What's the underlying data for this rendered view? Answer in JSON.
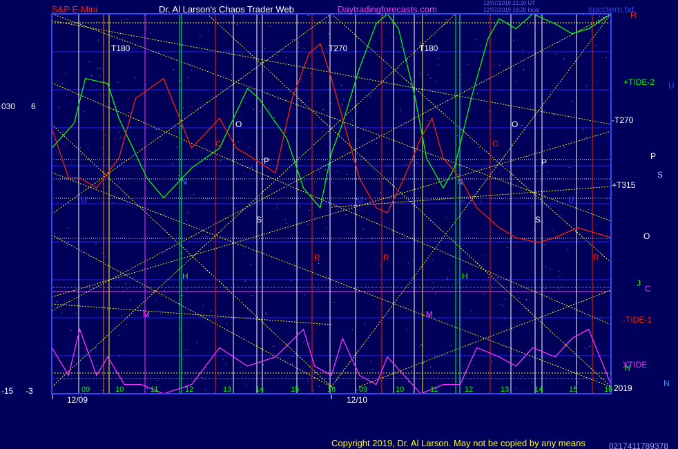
{
  "header": {
    "symbol": "S&P E-Mini",
    "title": "Dr. Al Larson's Chaos Trader Web",
    "site": "Daytradingforecasts.com",
    "stamp1": "12/07/2019 21:20 UT",
    "stamp2": "12/07/2019 16:20 local",
    "file": "spcctern.txt",
    "right_letter": "R"
  },
  "footer": {
    "copyright": "Copyright 2019, Dr. Al Larson. May not be copied by any means",
    "overlay_digits": "0217411789378"
  },
  "colors": {
    "background": "#00005a",
    "grid": "#2222ff",
    "yellow": "#ffff00",
    "green": "#00ff00",
    "red": "#ff2200",
    "magenta": "#ff33ff",
    "white": "#ffffff",
    "cyan": "#00ffcc",
    "orange": "#ff7700",
    "frame": "#3344ff"
  },
  "left_labels": {
    "top_a": "030",
    "top_b": "6",
    "bot_a": "-15",
    "bot_b": "-3"
  },
  "right_labels": [
    {
      "text": "+TIDE-2",
      "color": "#00ff00"
    },
    {
      "text": "U",
      "color": "#3344ff"
    },
    {
      "text": "-T270",
      "color": "#ffffff"
    },
    {
      "text": "P",
      "color": "#ffffff"
    },
    {
      "text": "S",
      "color": "#bbbbff"
    },
    {
      "text": "+T315",
      "color": "#ffffff"
    },
    {
      "text": "O",
      "color": "#ffffff"
    },
    {
      "text": "J",
      "color": "#00ff00"
    },
    {
      "text": "C",
      "color": "#ff33ff"
    },
    {
      "text": "-TIDE-1",
      "color": "#ff2200"
    },
    {
      "text": "XTIDE",
      "color": "#ff33ff"
    },
    {
      "text": "H",
      "color": "#00ff00"
    },
    {
      "text": "2019",
      "color": "#ffffff"
    },
    {
      "text": "N",
      "color": "#3399ff"
    }
  ],
  "t_labels": [
    "T180",
    "T270",
    "T180"
  ],
  "planet_labels": [
    {
      "text": "O",
      "color": "#ffffff"
    },
    {
      "text": "C",
      "color": "#ff2200"
    },
    {
      "text": "P",
      "color": "#ffffff"
    },
    {
      "text": "N",
      "color": "#3399ff"
    },
    {
      "text": "S",
      "color": "#ffffff"
    },
    {
      "text": "H",
      "color": "#00ff00"
    },
    {
      "text": "M",
      "color": "#ff33ff"
    },
    {
      "text": "R",
      "color": "#ff2200"
    },
    {
      "text": "U",
      "color": "#3344ff"
    },
    {
      "text": "O",
      "color": "#ffffff"
    },
    {
      "text": "C",
      "color": "#ff2200"
    },
    {
      "text": "P",
      "color": "#ffffff"
    },
    {
      "text": "N",
      "color": "#3399ff"
    },
    {
      "text": "S",
      "color": "#ffffff"
    },
    {
      "text": "H",
      "color": "#00ff00"
    },
    {
      "text": "M",
      "color": "#ff33ff"
    },
    {
      "text": "R",
      "color": "#ff2200"
    },
    {
      "text": "R",
      "color": "#ff2200"
    },
    {
      "text": "U",
      "color": "#3344ff"
    },
    {
      "text": "U",
      "color": "#3344ff"
    }
  ],
  "hour_labels": [
    "09",
    "10",
    "11",
    "12",
    "13",
    "14",
    "15",
    "16",
    "09",
    "10",
    "11",
    "12",
    "13",
    "14",
    "15",
    "16"
  ],
  "date_labels": [
    "12/09",
    "12/10"
  ],
  "chart_data": {
    "type": "line",
    "title": "S&P E-Mini",
    "x_axis": {
      "days": [
        "12/09",
        "12/10"
      ],
      "hours": [
        "09",
        "10",
        "11",
        "12",
        "13",
        "14",
        "15",
        "16"
      ]
    },
    "ylim_upper": [
      -15,
      30
    ],
    "ylim_lower": [
      -3,
      6
    ],
    "series": [
      {
        "name": "+TIDE-2",
        "color": "#00ff00",
        "x": [
          0,
          0.04,
          0.06,
          0.1,
          0.12,
          0.17,
          0.2,
          0.25,
          0.3,
          0.35,
          0.37,
          0.42,
          0.45,
          0.48,
          0.5,
          0.52,
          0.55,
          0.58,
          0.6,
          0.62,
          0.65,
          0.67,
          0.7,
          0.72,
          0.75,
          0.78,
          0.8,
          0.83,
          0.86,
          0.9,
          0.93,
          0.96,
          1.0
        ],
        "y": [
          -2,
          3,
          12,
          11,
          4,
          -8,
          -12,
          -6,
          -2,
          10,
          8,
          0,
          -10,
          -14,
          -3,
          3,
          14,
          23,
          25,
          22,
          8,
          -4,
          -10,
          -6,
          8,
          20,
          24,
          22,
          25,
          23,
          21,
          22,
          25
        ]
      },
      {
        "name": "-TIDE-1",
        "color": "#ff2200",
        "x": [
          0,
          0.03,
          0.05,
          0.08,
          0.12,
          0.15,
          0.2,
          0.25,
          0.3,
          0.33,
          0.36,
          0.4,
          0.43,
          0.46,
          0.48,
          0.5,
          0.52,
          0.55,
          0.58,
          0.6,
          0.63,
          0.66,
          0.68,
          0.7,
          0.73,
          0.76,
          0.8,
          0.83,
          0.87,
          0.9,
          0.94,
          0.97,
          1.0
        ],
        "y": [
          2,
          -8,
          -8,
          -10,
          -4,
          8,
          12,
          -2,
          4,
          -2,
          -4,
          -7,
          8,
          17,
          19,
          12,
          4,
          -8,
          -14,
          -15,
          -8,
          0,
          4,
          -4,
          -8,
          -14,
          -18,
          -20,
          -21,
          -20,
          -18,
          -19,
          -20
        ]
      },
      {
        "name": "XTIDE",
        "color": "#ff33ff",
        "x": [
          0,
          0.03,
          0.05,
          0.08,
          0.1,
          0.13,
          0.16,
          0.2,
          0.25,
          0.3,
          0.35,
          0.4,
          0.45,
          0.47,
          0.5,
          0.52,
          0.55,
          0.58,
          0.6,
          0.63,
          0.66,
          0.7,
          0.73,
          0.76,
          0.8,
          0.83,
          0.86,
          0.9,
          0.93,
          0.96,
          1.0
        ],
        "y": [
          2,
          -1,
          4,
          -1,
          1,
          -2,
          -2,
          -3,
          -2,
          2,
          0,
          1,
          4,
          0,
          -1,
          3,
          -1,
          -2,
          1,
          -1,
          -3,
          -2,
          -2,
          2,
          1,
          0,
          2,
          1,
          3,
          4,
          -2
        ]
      }
    ]
  }
}
